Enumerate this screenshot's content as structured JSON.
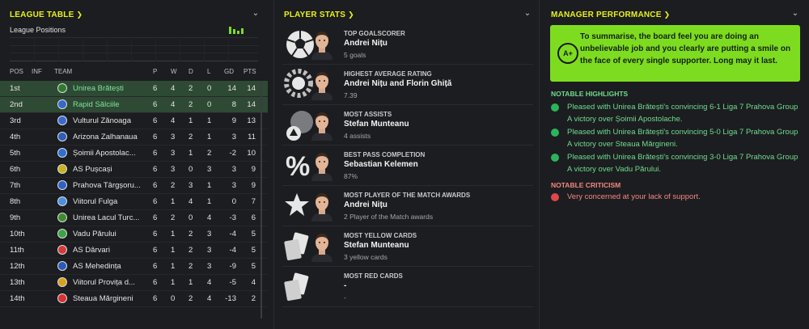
{
  "league": {
    "title": "LEAGUE TABLE",
    "positions_label": "League Positions",
    "headers": {
      "pos": "POS",
      "inf": "INF",
      "team": "TEAM",
      "p": "P",
      "w": "W",
      "d": "D",
      "l": "L",
      "gd": "GD",
      "pts": "PTS"
    },
    "rows": [
      {
        "pos": "1st",
        "team": "Unirea Brătești",
        "p": "6",
        "w": "4",
        "d": "2",
        "l": "0",
        "gd": "14",
        "pts": "14",
        "badge": "#2f7a2f"
      },
      {
        "pos": "2nd",
        "team": "Rapid Sălciile",
        "p": "6",
        "w": "4",
        "d": "2",
        "l": "0",
        "gd": "8",
        "pts": "14",
        "badge": "#3568c7"
      },
      {
        "pos": "3rd",
        "team": "Vulturul Zănoaga",
        "p": "6",
        "w": "4",
        "d": "1",
        "l": "1",
        "gd": "9",
        "pts": "13",
        "badge": "#3a6ad0"
      },
      {
        "pos": "4th",
        "team": "Arizona Zalhanaua",
        "p": "6",
        "w": "3",
        "d": "2",
        "l": "1",
        "gd": "3",
        "pts": "11",
        "badge": "#2b5fb8"
      },
      {
        "pos": "5th",
        "team": "Șoimii Apostolac...",
        "p": "6",
        "w": "3",
        "d": "1",
        "l": "2",
        "gd": "-2",
        "pts": "10",
        "badge": "#2e6fd1"
      },
      {
        "pos": "6th",
        "team": "AS Pușcași",
        "p": "6",
        "w": "3",
        "d": "0",
        "l": "3",
        "gd": "3",
        "pts": "9",
        "badge": "#c9b21d"
      },
      {
        "pos": "7th",
        "team": "Prahova Târgșoru...",
        "p": "6",
        "w": "2",
        "d": "3",
        "l": "1",
        "gd": "3",
        "pts": "9",
        "badge": "#2d62c4"
      },
      {
        "pos": "8th",
        "team": "Viitorul Fulga",
        "p": "6",
        "w": "1",
        "d": "4",
        "l": "1",
        "gd": "0",
        "pts": "7",
        "badge": "#4b8fe0"
      },
      {
        "pos": "9th",
        "team": "Unirea Lacul Turc...",
        "p": "6",
        "w": "2",
        "d": "0",
        "l": "4",
        "gd": "-3",
        "pts": "6",
        "badge": "#3f8c2f"
      },
      {
        "pos": "10th",
        "team": "Vadu Părului",
        "p": "6",
        "w": "1",
        "d": "2",
        "l": "3",
        "gd": "-4",
        "pts": "5",
        "badge": "#3aa445"
      },
      {
        "pos": "11th",
        "team": "AS Dârvari",
        "p": "6",
        "w": "1",
        "d": "2",
        "l": "3",
        "gd": "-4",
        "pts": "5",
        "badge": "#d33a3a"
      },
      {
        "pos": "12th",
        "team": "AS Mehedința",
        "p": "6",
        "w": "1",
        "d": "2",
        "l": "3",
        "gd": "-9",
        "pts": "5",
        "badge": "#2c5ab8"
      },
      {
        "pos": "13th",
        "team": "Viitorul Provița d...",
        "p": "6",
        "w": "1",
        "d": "1",
        "l": "4",
        "gd": "-5",
        "pts": "4",
        "badge": "#d8a21f"
      },
      {
        "pos": "14th",
        "team": "Steaua Mărgineni",
        "p": "6",
        "w": "0",
        "d": "2",
        "l": "4",
        "gd": "-13",
        "pts": "2",
        "badge": "#d63232"
      }
    ]
  },
  "stats": {
    "title": "PLAYER STATS",
    "items": [
      {
        "label": "TOP GOALSCORER",
        "name": "Andrei Nițu",
        "sub": "5 goals",
        "icon": "football-icon"
      },
      {
        "label": "HIGHEST AVERAGE RATING",
        "name": "Andrei Nițu and Florin Ghiță",
        "sub": "7.39",
        "icon": "rating-badge-icon"
      },
      {
        "label": "MOST ASSISTS",
        "name": "Stefan Munteanu",
        "sub": "4 assists",
        "icon": "assist-icon"
      },
      {
        "label": "BEST PASS COMPLETION",
        "name": "Sebastian Kelemen",
        "sub": "87%",
        "icon": "percent-icon"
      },
      {
        "label": "MOST PLAYER OF THE MATCH AWARDS",
        "name": "Andrei Nițu",
        "sub": "2 Player of the Match awards",
        "icon": "star-icon"
      },
      {
        "label": "MOST YELLOW CARDS",
        "name": "Stefan Munteanu",
        "sub": "3 yellow cards",
        "icon": "yellow-card-icon"
      },
      {
        "label": "MOST RED CARDS",
        "name": "-",
        "sub": "-",
        "icon": "red-card-icon"
      }
    ]
  },
  "manager": {
    "title": "MANAGER PERFORMANCE",
    "grade": "A+",
    "summary": "To summarise, the board feel you are doing an unbelievable job and you clearly are putting a smile on the face of every single supporter. Long may it last.",
    "highlights_title": "NOTABLE HIGHLIGHTS",
    "highlights": [
      "Pleased with Unirea Brătești's convincing 6-1 Liga 7 Prahova Group A victory over Șoimii Apostolache.",
      "Pleased with Unirea Brătești's convincing 5-0 Liga 7 Prahova Group A victory over Steaua Mărgineni.",
      "Pleased with Unirea Brătești's convincing 3-0 Liga 7 Prahova Group A victory over Vadu Părului."
    ],
    "criticism_title": "NOTABLE CRITICISM",
    "criticism": "Very concerned at your lack of support."
  },
  "colors": {
    "accent": "#e7f01e",
    "summary_bg": "#7ddc1f",
    "highlight": "#6fdc8f",
    "critical": "#f3877f",
    "row_highlight": "#2e4a34"
  }
}
